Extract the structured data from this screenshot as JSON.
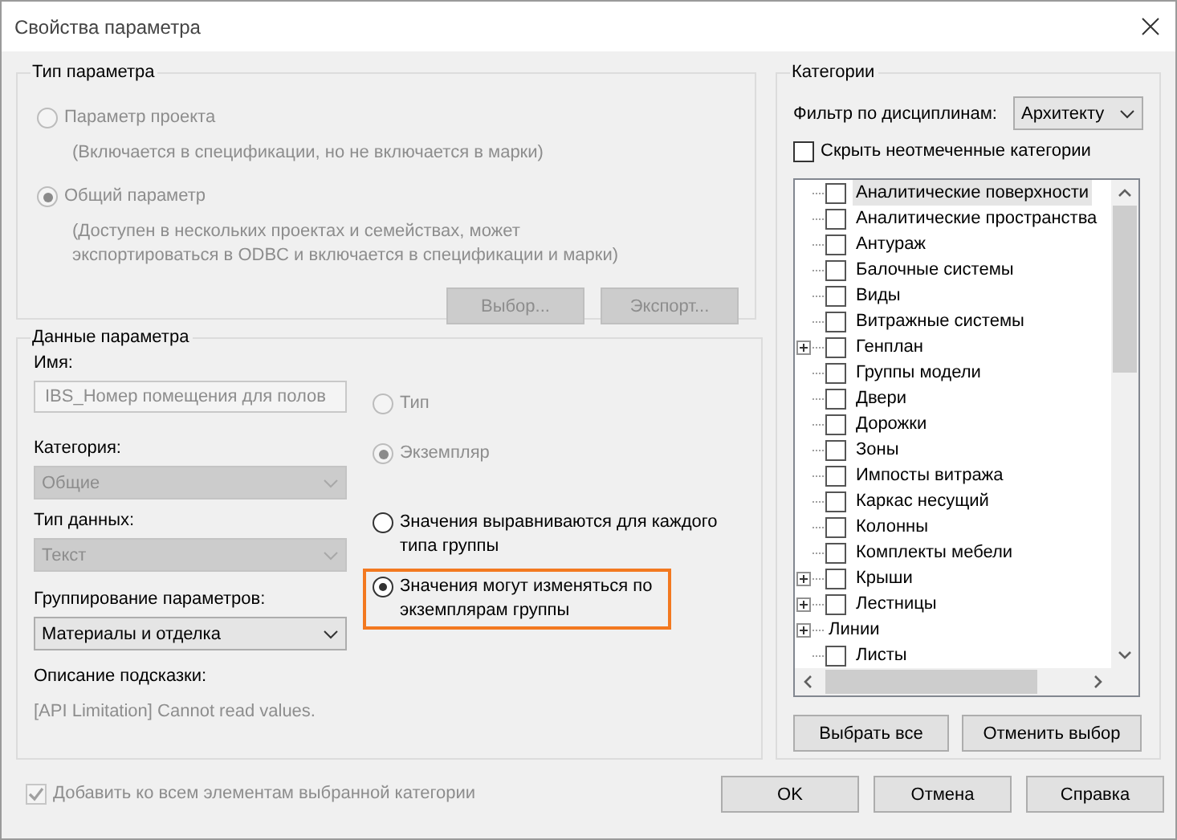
{
  "window": {
    "title": "Свойства параметра"
  },
  "parameter_type": {
    "title": "Тип параметра",
    "options": [
      {
        "label": "Параметр проекта",
        "description": "(Включается в спецификации, но не включается в марки)",
        "selected": false,
        "disabled": true
      },
      {
        "label": "Общий параметр",
        "description": "(Доступен в нескольких проектах и семействах, может экспортироваться в ODBC и включается в спецификации и марки)",
        "selected": true,
        "disabled": true
      }
    ],
    "buttons": [
      {
        "label": "Выбор...",
        "disabled": true
      },
      {
        "label": "Экспорт...",
        "disabled": true
      }
    ]
  },
  "parameter_data": {
    "title": "Данные параметра",
    "name": {
      "label": "Имя:",
      "value": "IBS_Номер помещения для полов",
      "disabled": true
    },
    "category": {
      "label": "Категория:",
      "value": "Общие",
      "disabled": true
    },
    "data_type": {
      "label": "Тип данных:",
      "value": "Текст",
      "disabled": true
    },
    "grouping": {
      "label": "Группирование параметров:",
      "value": "Материалы и отделка",
      "disabled": false
    },
    "tooltip": {
      "label": "Описание подсказки:",
      "value": "[API Limitation] Cannot read values."
    },
    "type_instance": [
      {
        "label": "Тип",
        "selected": false,
        "disabled": true
      },
      {
        "label": "Экземпляр",
        "selected": true,
        "disabled": true
      }
    ],
    "group_values": [
      {
        "label": "Значения выравниваются для каждого типа группы",
        "selected": false,
        "disabled": false,
        "highlighted": false
      },
      {
        "label": "Значения могут изменяться по экземплярам группы",
        "selected": true,
        "disabled": false,
        "highlighted": true
      }
    ]
  },
  "categories": {
    "title": "Категории",
    "filter": {
      "label": "Фильтр по дисциплинам:",
      "value": "Архитекту"
    },
    "hide_unchecked": {
      "label": "Скрыть неотмеченные категории",
      "checked": false,
      "disabled": false
    },
    "tree": [
      {
        "label": "Аналитические поверхности",
        "kind": "leaf",
        "checked": false,
        "selected": true
      },
      {
        "label": "Аналитические пространства",
        "kind": "leaf",
        "checked": false,
        "selected": false
      },
      {
        "label": "Антураж",
        "kind": "leaf",
        "checked": false,
        "selected": false
      },
      {
        "label": "Балочные системы",
        "kind": "leaf",
        "checked": false,
        "selected": false
      },
      {
        "label": "Виды",
        "kind": "leaf",
        "checked": false,
        "selected": false
      },
      {
        "label": "Витражные системы",
        "kind": "leaf",
        "checked": false,
        "selected": false
      },
      {
        "label": "Генплан",
        "kind": "collapsed",
        "checked": false,
        "selected": false
      },
      {
        "label": "Группы модели",
        "kind": "leaf",
        "checked": false,
        "selected": false
      },
      {
        "label": "Двери",
        "kind": "leaf",
        "checked": false,
        "selected": false
      },
      {
        "label": "Дорожки",
        "kind": "leaf",
        "checked": false,
        "selected": false
      },
      {
        "label": "Зоны",
        "kind": "leaf",
        "checked": false,
        "selected": false
      },
      {
        "label": "Импосты витража",
        "kind": "leaf",
        "checked": false,
        "selected": false
      },
      {
        "label": "Каркас несущий",
        "kind": "leaf",
        "checked": false,
        "selected": false
      },
      {
        "label": "Колонны",
        "kind": "leaf",
        "checked": false,
        "selected": false
      },
      {
        "label": "Комплекты мебели",
        "kind": "leaf",
        "checked": false,
        "selected": false
      },
      {
        "label": "Крыши",
        "kind": "collapsed",
        "checked": false,
        "selected": false
      },
      {
        "label": "Лестницы",
        "kind": "collapsed",
        "checked": false,
        "selected": false
      },
      {
        "label": "Линии",
        "kind": "heading",
        "selected": false
      },
      {
        "label": "Листы",
        "kind": "leaf",
        "checked": false,
        "selected": false
      }
    ],
    "buttons": [
      {
        "label": "Выбрать все",
        "disabled": false
      },
      {
        "label": "Отменить выбор",
        "disabled": false
      }
    ]
  },
  "add_to_all": {
    "label": "Добавить ко всем элементам выбранной категории",
    "checked": true,
    "disabled": true
  },
  "buttons": [
    {
      "label": "OK",
      "disabled": false
    },
    {
      "label": "Отмена",
      "disabled": false
    },
    {
      "label": "Справка",
      "disabled": false
    }
  ]
}
